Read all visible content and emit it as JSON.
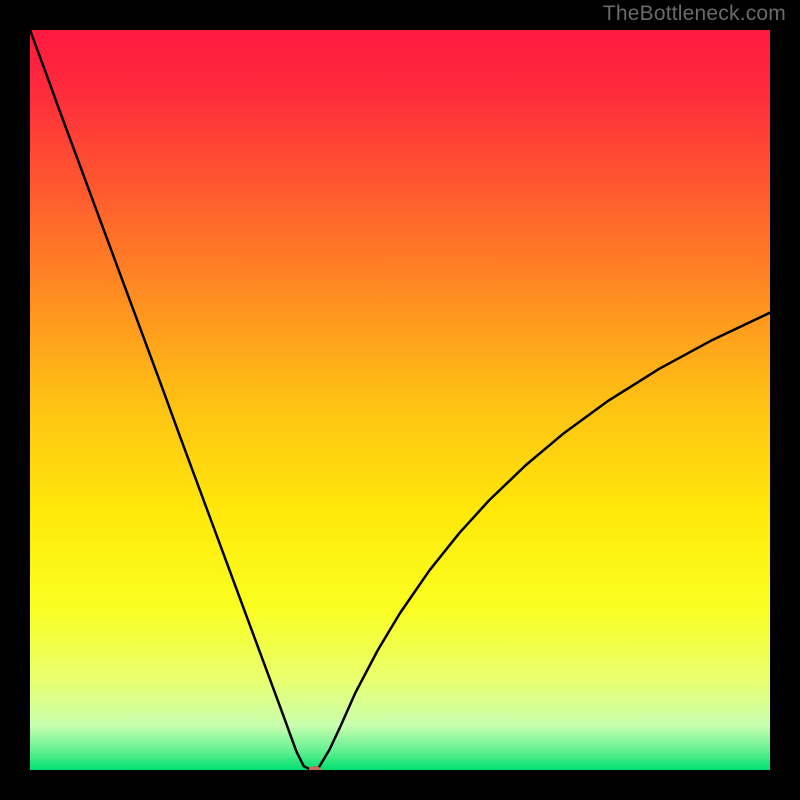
{
  "attribution": "TheBottleneck.com",
  "chart_data": {
    "type": "line",
    "title": "",
    "xlabel": "",
    "ylabel": "",
    "xlim": [
      0,
      100
    ],
    "ylim": [
      0,
      100
    ],
    "background_gradient": {
      "stops": [
        {
          "offset": 0.0,
          "color": "#ff1a40"
        },
        {
          "offset": 0.08,
          "color": "#ff2a3c"
        },
        {
          "offset": 0.2,
          "color": "#ff5430"
        },
        {
          "offset": 0.35,
          "color": "#ff8a22"
        },
        {
          "offset": 0.5,
          "color": "#ffc014"
        },
        {
          "offset": 0.65,
          "color": "#ffe80a"
        },
        {
          "offset": 0.78,
          "color": "#faff20"
        },
        {
          "offset": 0.88,
          "color": "#e8ff70"
        },
        {
          "offset": 0.94,
          "color": "#c8ffb0"
        },
        {
          "offset": 0.975,
          "color": "#60f090"
        },
        {
          "offset": 1.0,
          "color": "#00e070"
        }
      ]
    },
    "series": [
      {
        "name": "bottleneck-curve",
        "stroke": "#000000",
        "stroke_width": 2.5,
        "x": [
          0,
          2,
          4,
          6,
          8,
          10,
          12,
          14,
          16,
          18,
          20,
          22,
          24,
          26,
          28,
          30,
          32,
          34,
          36,
          37,
          38,
          38.5,
          39,
          40.5,
          42,
          44,
          47,
          50,
          54,
          58,
          62,
          67,
          72,
          78,
          85,
          92,
          100
        ],
        "y": [
          100,
          94.6,
          89.1,
          83.7,
          78.3,
          72.9,
          67.5,
          62.1,
          56.7,
          51.3,
          45.8,
          40.4,
          35.0,
          29.6,
          24.2,
          18.8,
          13.4,
          8.0,
          2.5,
          0.5,
          0.0,
          0.0,
          0.3,
          2.8,
          6.0,
          10.5,
          16.2,
          21.2,
          27.0,
          32.0,
          36.4,
          41.2,
          45.4,
          49.8,
          54.2,
          58.0,
          61.8
        ]
      }
    ],
    "marker": {
      "name": "optimal-point",
      "x": 38.5,
      "y": 0,
      "rx": 6,
      "ry": 4,
      "fill": "#c86a5a"
    }
  }
}
